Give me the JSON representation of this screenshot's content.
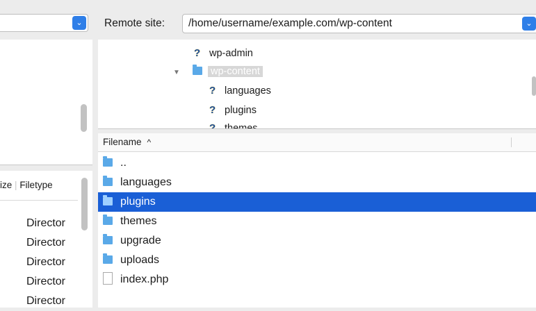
{
  "local": {
    "header": {
      "size_col": "ize",
      "type_col": "Filetype"
    },
    "rows": [
      "Director",
      "Director",
      "Director",
      "Director",
      "Director"
    ]
  },
  "remote": {
    "label": "Remote site:",
    "path": "/home/username/example.com/wp-content",
    "tree": [
      {
        "name": "wp-admin",
        "icon": "question-icon"
      },
      {
        "name": "wp-content",
        "icon": "folder-icon",
        "selected": true,
        "expanded": true
      },
      {
        "name": "languages",
        "icon": "question-icon"
      },
      {
        "name": "plugins",
        "icon": "question-icon"
      },
      {
        "name": "themes",
        "icon": "question-icon"
      }
    ],
    "list_header": {
      "filename": "Filename",
      "sort": "^"
    },
    "files": [
      {
        "name": "..",
        "icon": "folder-icon"
      },
      {
        "name": "languages",
        "icon": "folder-icon"
      },
      {
        "name": "plugins",
        "icon": "folder-icon",
        "selected": true
      },
      {
        "name": "themes",
        "icon": "folder-icon"
      },
      {
        "name": "upgrade",
        "icon": "folder-icon"
      },
      {
        "name": "uploads",
        "icon": "folder-icon"
      },
      {
        "name": "index.php",
        "icon": "file-icon"
      }
    ]
  },
  "colors": {
    "selection": "#1a5fd6",
    "accent": "#2f7fe8",
    "folder": "#5aa9e8"
  }
}
